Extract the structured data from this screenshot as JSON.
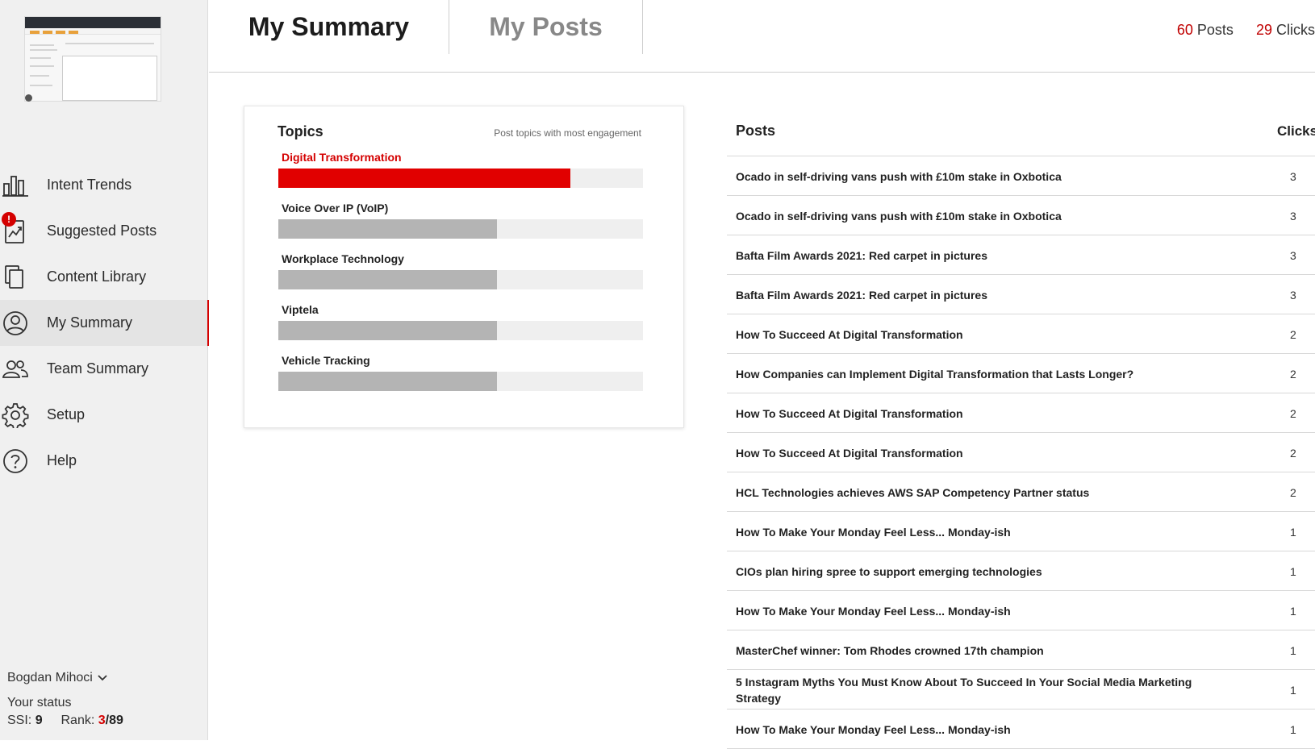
{
  "sidebar": {
    "nav": [
      {
        "label": "Intent Trends",
        "icon": "bar-chart-icon"
      },
      {
        "label": "Suggested Posts",
        "icon": "trend-document-icon",
        "badge": "!"
      },
      {
        "label": "Content Library",
        "icon": "documents-icon"
      },
      {
        "label": "My Summary",
        "icon": "user-circle-icon",
        "active": true
      },
      {
        "label": "Team Summary",
        "icon": "team-icon"
      },
      {
        "label": "Setup",
        "icon": "gear-icon"
      },
      {
        "label": "Help",
        "icon": "help-icon"
      }
    ],
    "user_name": "Bogdan Mihoci",
    "status_label": "Your status",
    "ssi_label": "SSI:",
    "ssi_value": "9",
    "rank_label": "Rank:",
    "rank_value": "3",
    "rank_total": "/89"
  },
  "header": {
    "tabs": [
      "My Summary",
      "My Posts"
    ],
    "posts_count": "60",
    "posts_label": "Posts",
    "clicks_count": "29",
    "clicks_label": "Clicks"
  },
  "topics": {
    "title": "Topics",
    "subtitle": "Post topics with most engagement",
    "items": [
      {
        "label": "Digital Transformation",
        "value": 0.8,
        "highlight": true
      },
      {
        "label": "Voice Over IP (VoIP)",
        "value": 0.6
      },
      {
        "label": "Workplace Technology",
        "value": 0.6
      },
      {
        "label": "Viptela",
        "value": 0.6
      },
      {
        "label": "Vehicle Tracking",
        "value": 0.6
      }
    ]
  },
  "posts": {
    "col_posts": "Posts",
    "col_clicks": "Clicks",
    "rows": [
      {
        "title": "Ocado in self-driving vans push with £10m stake in Oxbotica",
        "clicks": "3"
      },
      {
        "title": "Ocado in self-driving vans push with £10m stake in Oxbotica",
        "clicks": "3"
      },
      {
        "title": "Bafta Film Awards 2021: Red carpet in pictures",
        "clicks": "3"
      },
      {
        "title": "Bafta Film Awards 2021: Red carpet in pictures",
        "clicks": "3"
      },
      {
        "title": "How To Succeed At Digital Transformation",
        "clicks": "2"
      },
      {
        "title": "How Companies can Implement Digital Transformation that Lasts Longer?",
        "clicks": "2"
      },
      {
        "title": "How To Succeed At Digital Transformation",
        "clicks": "2"
      },
      {
        "title": "How To Succeed At Digital Transformation",
        "clicks": "2"
      },
      {
        "title": "HCL Technologies achieves AWS SAP Competency Partner status",
        "clicks": "2"
      },
      {
        "title": "How To Make Your Monday Feel Less... Monday-ish",
        "clicks": "1"
      },
      {
        "title": "CIOs plan hiring spree to support emerging technologies",
        "clicks": "1"
      },
      {
        "title": "How To Make Your Monday Feel Less... Monday-ish",
        "clicks": "1"
      },
      {
        "title": "MasterChef winner: Tom Rhodes crowned 17th champion",
        "clicks": "1"
      },
      {
        "title": "5 Instagram Myths You Must Know About To Succeed In Your Social Media Marketing Strategy",
        "clicks": "1"
      },
      {
        "title": "How To Make Your Monday Feel Less... Monday-ish",
        "clicks": "1"
      }
    ]
  },
  "colors": {
    "accent": "#d40000",
    "bar_highlight": "#e10000",
    "bar_default": "#b4b4b4",
    "track": "#efefef"
  }
}
